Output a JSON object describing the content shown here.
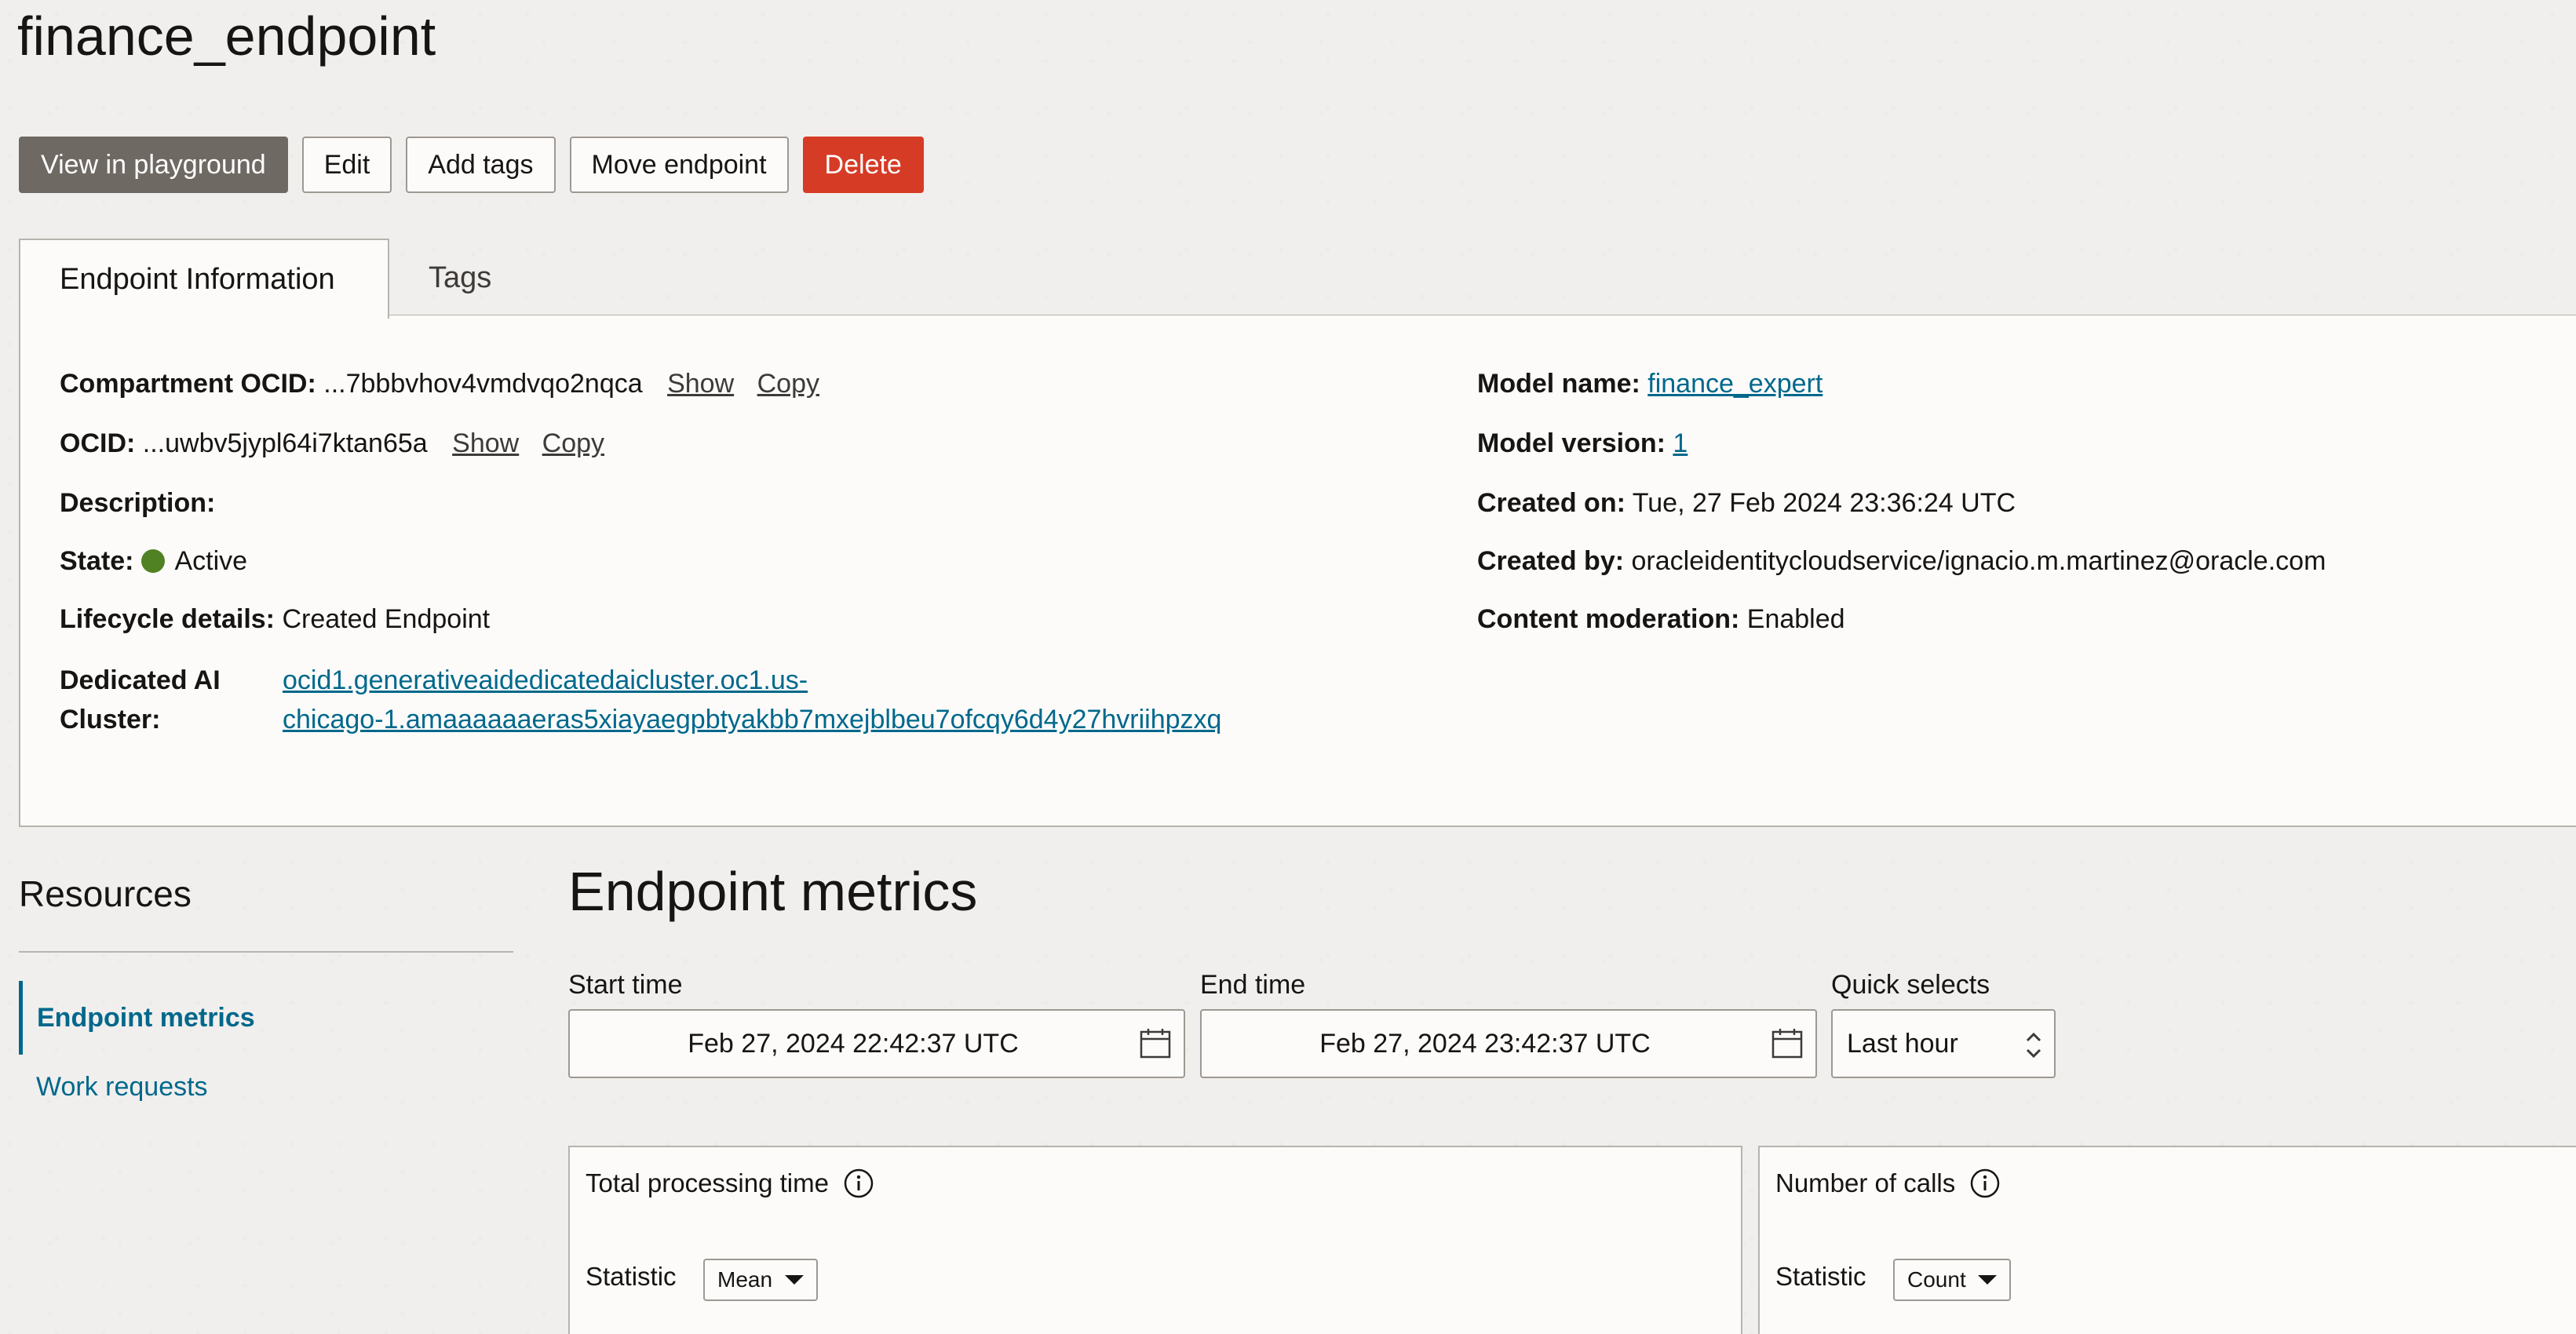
{
  "page": {
    "title": "finance_endpoint"
  },
  "toolbar": {
    "view_playground": "View in playground",
    "edit": "Edit",
    "add_tags": "Add tags",
    "move_endpoint": "Move endpoint",
    "delete": "Delete"
  },
  "tabs": [
    {
      "label": "Endpoint Information",
      "active": true
    },
    {
      "label": "Tags",
      "active": false
    }
  ],
  "info": {
    "compartment_label": "Compartment OCID:",
    "compartment_value": "...7bbbvhov4vmdvqo2nqca",
    "ocid_label": "OCID:",
    "ocid_value": "...uwbv5jypl64i7ktan65a",
    "show": "Show",
    "copy": "Copy",
    "description_label": "Description:",
    "state_label": "State:",
    "state_value": "Active",
    "state_color": "#508223",
    "lifecycle_label": "Lifecycle details:",
    "lifecycle_value": "Created Endpoint",
    "cluster_label_1": "Dedicated AI",
    "cluster_label_2": "Cluster:",
    "cluster_value_1": "ocid1.generativeaidedicatedaicluster.oc1.us-",
    "cluster_value_2": "chicago-1.amaaaaaaeras5xiayaegpbtyakbb7mxejblbeu7ofcqy6d4y27hvriihpzxq",
    "model_name_label": "Model name:",
    "model_name_value": "finance_expert",
    "model_version_label": "Model version:",
    "model_version_value": "1",
    "created_on_label": "Created on:",
    "created_on_value": "Tue, 27 Feb 2024 23:36:24 UTC",
    "created_by_label": "Created by:",
    "created_by_value": "oracleidentitycloudservice/ignacio.m.martinez@oracle.com",
    "moderation_label": "Content moderation:",
    "moderation_value": "Enabled"
  },
  "resources": {
    "title": "Resources",
    "items": [
      {
        "label": "Endpoint metrics",
        "active": true
      },
      {
        "label": "Work requests",
        "active": false
      }
    ]
  },
  "metrics": {
    "title": "Endpoint metrics",
    "start_label": "Start time",
    "start_value": "Feb 27, 2024 22:42:37 UTC",
    "end_label": "End time",
    "end_value": "Feb 27, 2024 23:42:37 UTC",
    "quick_label": "Quick selects",
    "quick_value": "Last hour",
    "cards": [
      {
        "title": "Total processing time",
        "statistic_label": "Statistic",
        "statistic_value": "Mean"
      },
      {
        "title": "Number of calls",
        "statistic_label": "Statistic",
        "statistic_value": "Count"
      }
    ]
  },
  "colors": {
    "primary_button": "#6f6964",
    "danger_button": "#d63b25",
    "link": "#00688c"
  }
}
